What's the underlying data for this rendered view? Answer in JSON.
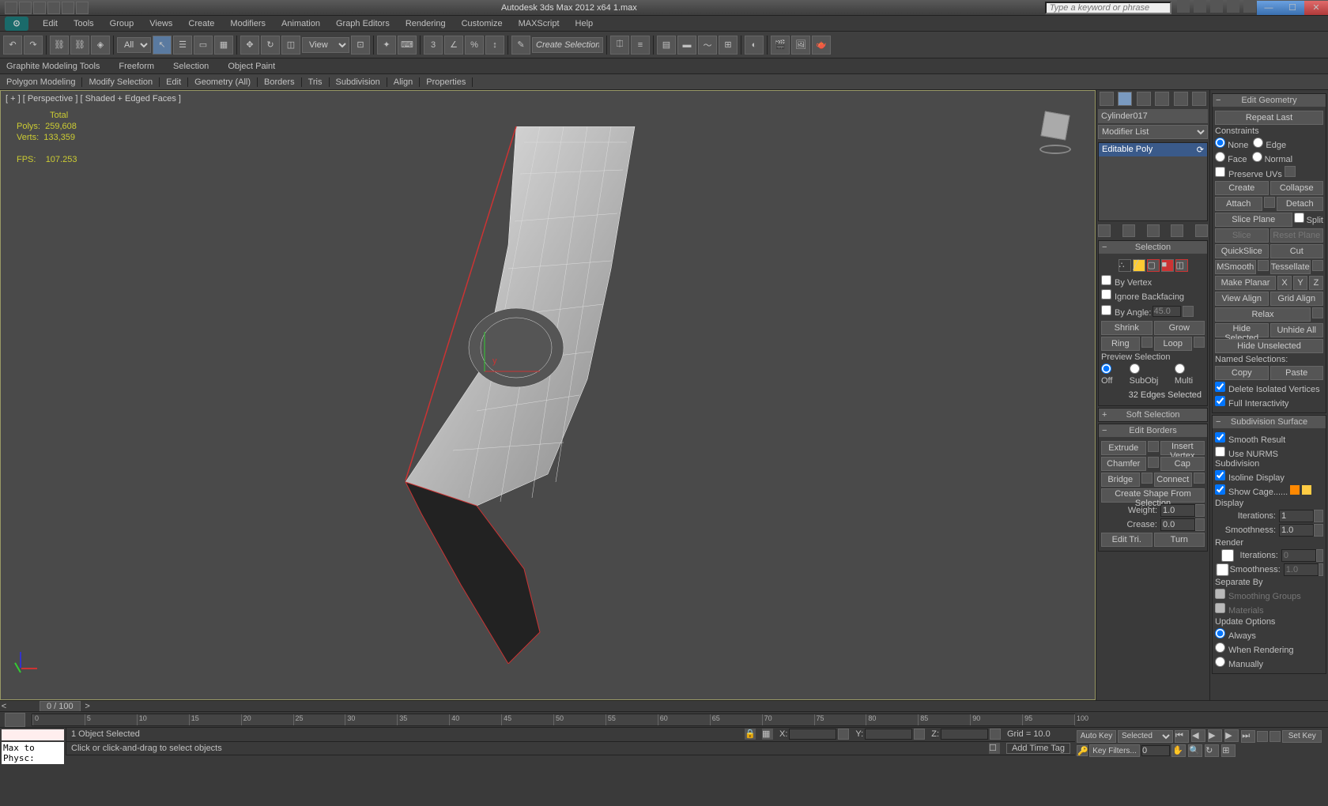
{
  "app": {
    "title": "Autodesk 3ds Max 2012 x64     1.max",
    "search_placeholder": "Type a keyword or phrase"
  },
  "menu": [
    "Edit",
    "Tools",
    "Group",
    "Views",
    "Create",
    "Modifiers",
    "Animation",
    "Graph Editors",
    "Rendering",
    "Customize",
    "MAXScript",
    "Help"
  ],
  "toolbar": {
    "selection_filter": "All",
    "view_dropdown": "View",
    "spinner_val": "3",
    "create_sel_set": "Create Selection Se"
  },
  "ribbon": {
    "tabs": [
      "Graphite Modeling Tools",
      "Freeform",
      "Selection",
      "Object Paint"
    ],
    "sub": [
      "Polygon Modeling",
      "Modify Selection",
      "Edit",
      "Geometry (All)",
      "Borders",
      "Tris",
      "Subdivision",
      "Align",
      "Properties"
    ]
  },
  "viewport": {
    "label": "[ + ] [ Perspective ] [ Shaded + Edged Faces ]",
    "stats_hdr": "Total",
    "polys_lbl": "Polys:",
    "polys": "259,608",
    "verts_lbl": "Verts:",
    "verts": "133,359",
    "fps_lbl": "FPS:",
    "fps": "107.253",
    "axis_y": "y"
  },
  "cmd": {
    "object_name": "Cylinder017",
    "modifier_list": "Modifier List",
    "stack_item": "Editable Poly",
    "selection_hdr": "Selection",
    "by_vertex": "By Vertex",
    "ignore_backfacing": "Ignore Backfacing",
    "by_angle": "By Angle:",
    "by_angle_val": "45.0",
    "shrink": "Shrink",
    "grow": "Grow",
    "ring": "Ring",
    "loop": "Loop",
    "preview_sel": "Preview Selection",
    "off": "Off",
    "subobj": "SubObj",
    "multi": "Multi",
    "edges_selected": "32 Edges Selected",
    "soft_sel_hdr": "Soft Selection",
    "edit_borders_hdr": "Edit Borders",
    "extrude": "Extrude",
    "insert_vertex": "Insert Vertex",
    "chamfer": "Chamfer",
    "cap": "Cap",
    "bridge": "Bridge",
    "connect": "Connect",
    "create_shape": "Create Shape From Selection",
    "weight": "Weight:",
    "weight_val": "1.0",
    "crease": "Crease:",
    "crease_val": "0.0",
    "edit_tri": "Edit Tri.",
    "turn": "Turn"
  },
  "geo": {
    "hdr": "Edit Geometry",
    "repeat_last": "Repeat Last",
    "constraints": "Constraints",
    "none": "None",
    "edge": "Edge",
    "face": "Face",
    "normal": "Normal",
    "preserve_uvs": "Preserve UVs",
    "create": "Create",
    "collapse": "Collapse",
    "attach": "Attach",
    "detach": "Detach",
    "slice_plane": "Slice Plane",
    "split": "Split",
    "slice": "Slice",
    "reset_plane": "Reset Plane",
    "quickslice": "QuickSlice",
    "cut": "Cut",
    "msmooth": "MSmooth",
    "tessellate": "Tessellate",
    "make_planar": "Make Planar",
    "x": "X",
    "y": "Y",
    "z": "Z",
    "view_align": "View Align",
    "grid_align": "Grid Align",
    "relax": "Relax",
    "hide_sel": "Hide Selected",
    "unhide_all": "Unhide All",
    "hide_unsel": "Hide Unselected",
    "named_sel": "Named Selections:",
    "copy": "Copy",
    "paste": "Paste",
    "del_iso": "Delete Isolated Vertices",
    "full_int": "Full Interactivity",
    "subdiv_hdr": "Subdivision Surface",
    "smooth_result": "Smooth Result",
    "use_nurms": "Use NURMS Subdivision",
    "isoline": "Isoline Display",
    "show_cage": "Show Cage......",
    "display": "Display",
    "iterations": "Iterations:",
    "iter_val": "1",
    "smoothness": "Smoothness:",
    "smooth_val": "1.0",
    "render": "Render",
    "r_iter_val": "0",
    "r_smooth_val": "1.0",
    "sep_by": "Separate By",
    "smoothing_groups": "Smoothing Groups",
    "materials": "Materials",
    "update_opts": "Update Options",
    "always": "Always",
    "when_rendering": "When Rendering",
    "manually": "Manually"
  },
  "timeline": {
    "slider": "0 / 100",
    "ticks": [
      0,
      5,
      10,
      15,
      20,
      25,
      30,
      35,
      40,
      45,
      50,
      55,
      60,
      65,
      70,
      75,
      80,
      85,
      90,
      95,
      100
    ]
  },
  "status": {
    "max_physc": "Max to Physc:",
    "selected": "1 Object Selected",
    "hint": "Click or click-and-drag to select objects",
    "x": "X:",
    "y": "Y:",
    "z": "Z:",
    "grid": "Grid = 10.0",
    "add_time_tag": "Add Time Tag",
    "auto_key": "Auto Key",
    "set_key": "Set Key",
    "key_mode": "Selected",
    "key_filters": "Key Filters..."
  }
}
